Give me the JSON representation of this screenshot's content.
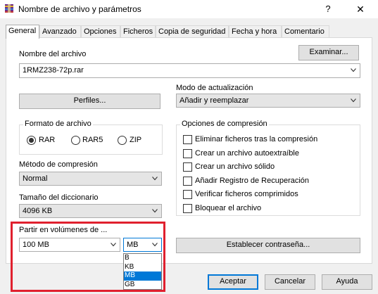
{
  "window": {
    "title": "Nombre de archivo y parámetros",
    "help_label": "?",
    "close_label": "✕"
  },
  "tabs": [
    "General",
    "Avanzado",
    "Opciones",
    "Ficheros",
    "Copia de seguridad",
    "Fecha y hora",
    "Comentario"
  ],
  "archive": {
    "name_label": "Nombre del archivo",
    "browse_label": "Examinar...",
    "name_value": "1RMZ238-72p.rar"
  },
  "profiles_label": "Perfiles...",
  "update_mode": {
    "label": "Modo de actualización",
    "value": "Añadir y reemplazar"
  },
  "format": {
    "title": "Formato de archivo",
    "options": [
      "RAR",
      "RAR5",
      "ZIP"
    ],
    "selected": "RAR"
  },
  "options_group": {
    "title": "Opciones de compresión",
    "items": [
      "Eliminar ficheros tras la compresión",
      "Crear un archivo autoextraíble",
      "Crear un archivo sólido",
      "Añadir Registro de Recuperación",
      "Verificar ficheros comprimidos",
      "Bloquear el archivo"
    ]
  },
  "compression": {
    "label": "Método de compresión",
    "value": "Normal"
  },
  "dictionary": {
    "label": "Tamaño del diccionario",
    "value": "4096 KB"
  },
  "split": {
    "label": "Partir en volúmenes de ...",
    "size_value": "100 MB",
    "unit_value": "MB",
    "unit_options": [
      "B",
      "KB",
      "MB",
      "GB"
    ],
    "unit_selected": "MB"
  },
  "password_label": "Establecer contraseña...",
  "footer": {
    "ok_label": "Aceptar",
    "cancel_label": "Cancelar",
    "help_label": "Ayuda"
  },
  "colors": {
    "accent": "#0078d7",
    "highlight_box": "#e0202e"
  }
}
